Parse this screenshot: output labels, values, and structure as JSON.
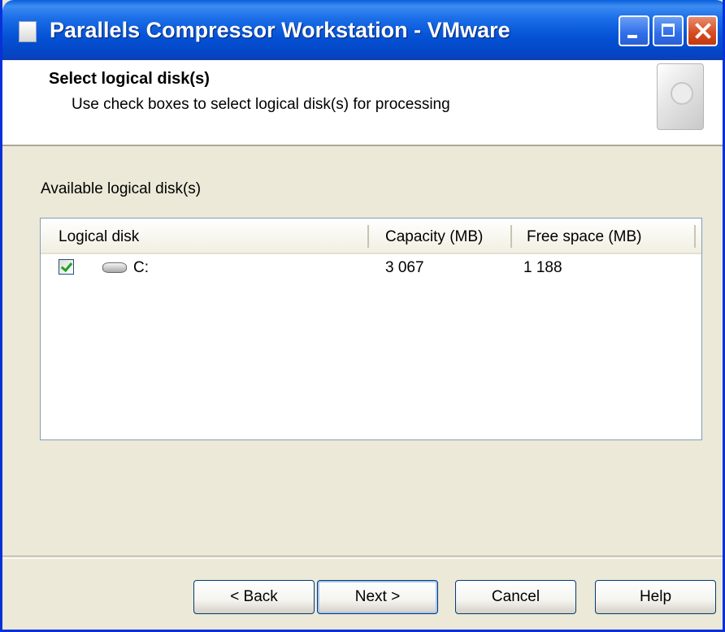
{
  "window": {
    "title": "Parallels Compressor Workstation - VMware"
  },
  "header": {
    "title": "Select logical disk(s)",
    "subtitle": "Use check boxes to select logical disk(s) for processing",
    "icon": "hard-disk-icon"
  },
  "main": {
    "available_label": "Available logical disk(s)",
    "columns": [
      "Logical disk",
      "Capacity (MB)",
      "Free space (MB)"
    ],
    "rows": [
      {
        "checked": true,
        "icon": "drive-icon",
        "disk": "C:",
        "capacity": "3 067",
        "free": "1 188"
      }
    ]
  },
  "buttons": {
    "back": "< Back",
    "next": "Next >",
    "cancel": "Cancel",
    "help": "Help"
  },
  "colors": {
    "titlebar": "#0553d6",
    "dialog_bg": "#ece9d8",
    "check": "#21a121"
  }
}
